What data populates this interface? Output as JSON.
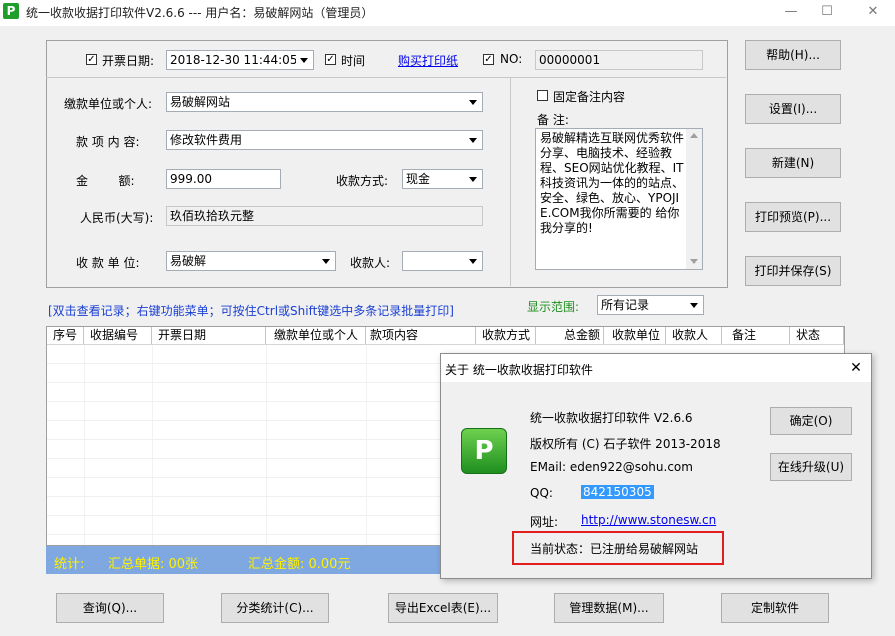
{
  "window": {
    "title": "统一收款收据打印软件V2.6.6 --- 用户名：易破解网站（管理员）",
    "app_icon_letter": "P",
    "minimize": "—",
    "maximize": "☐",
    "close": "✕"
  },
  "form": {
    "invoice_date_label": "开票日期:",
    "invoice_date_checked": true,
    "invoice_date_value": "2018-12-30 11:44:05",
    "time_label": "时间",
    "time_checked": true,
    "buy_paper_link": "购买打印纸",
    "no_checked": true,
    "no_label": "NO:",
    "no_value": "00000001",
    "payer_label": "缴款单位或个人:",
    "payer_value": "易破解网站",
    "item_label": "款 项 内 容:",
    "item_value": "修改软件费用",
    "amount_label": "金        额:",
    "amount_value": "999.00",
    "pay_method_label": "收款方式:",
    "pay_method_value": "现金",
    "rmb_label": "人民币(大写):",
    "rmb_value": "玖佰玖拾玖元整",
    "payee_unit_label": "收 款 单 位:",
    "payee_unit_value": "易破解",
    "payee_label": "收款人:",
    "payee_value": "",
    "fixed_note_label": "固定备注内容",
    "fixed_note_checked": false,
    "note_label": "备 注:",
    "note_text": "易破解精选互联网优秀软件分享、电脑技术、经验教程、SEO网站优化教程、IT科技资讯为一体的的站点、安全、绿色、放心、YPOJIE.COM我你所需要的 给你我分享的!"
  },
  "side_buttons": {
    "help": "帮助(H)...",
    "settings": "设置(I)...",
    "new": "新建(N)",
    "print_preview": "打印预览(P)...",
    "print_save": "打印并保存(S)"
  },
  "hint_text": "[双击查看记录；右键功能菜单；可按住Ctrl或Shift键选中多条记录批量打印]",
  "display_range": {
    "label": "显示范围:",
    "value": "所有记录"
  },
  "table": {
    "columns": [
      "序号",
      "收据编号",
      "开票日期",
      "缴款单位或个人",
      "款项内容",
      "收款方式",
      "总金额",
      "收款单位",
      "收款人",
      "备注",
      "状态"
    ],
    "rows": []
  },
  "status_bar": {
    "stats_label": "统计:",
    "count_text": "汇总单据: 00张",
    "sum_text": "汇总金额: 0.00元"
  },
  "bottom_buttons": {
    "query": "查询(Q)...",
    "category_stats": "分类统计(C)...",
    "export_excel": "导出Excel表(E)...",
    "manage_data": "管理数据(M)...",
    "customize": "定制软件"
  },
  "about_dialog": {
    "title": "关于 统一收款收据打印软件",
    "product": "统一收款收据打印软件 V2.6.6",
    "copyright": "版权所有 (C) 石子软件 2013-2018",
    "email": "EMail: eden922@sohu.com",
    "qq_label": "QQ:",
    "qq_value": "842150305",
    "website_label": "网址:",
    "website_value": "http://www.stonesw.cn",
    "status": "当前状态：已注册给易破解网站",
    "ok_button": "确定(O)",
    "upgrade_button": "在线升级(U)",
    "close": "✕"
  },
  "colors": {
    "status_bar_bg": "#7fa7e0",
    "status_text": "#fff200",
    "hint_text": "#1a3fd4",
    "display_range_label": "#1f8f1f",
    "link": "#0000ee",
    "highlight_box": "#e11d1d",
    "selection_bg": "#3399ff"
  }
}
